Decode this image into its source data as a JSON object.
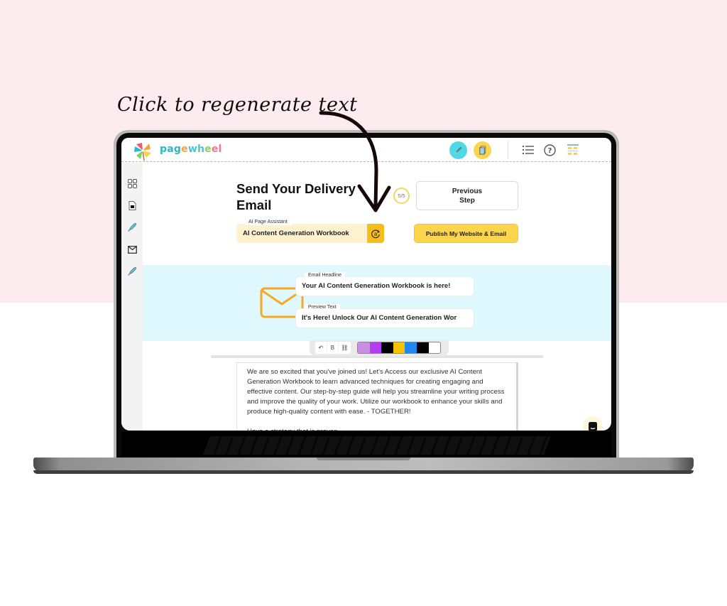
{
  "annotation": {
    "callout_text": "Click to regenerate text",
    "arrow_icon": "curved-arrow-down"
  },
  "colors": {
    "background_top": "#fdecef",
    "background_bottom": "#ffffff",
    "accent_yellow": "#fbd54c",
    "regen_yellow": "#f7be1a",
    "email_band": "#dff8fd",
    "envelope_orange": "#f9a826"
  },
  "app": {
    "brand": {
      "name_letters": [
        {
          "ch": "p",
          "color": "#2bb8c7"
        },
        {
          "ch": "a",
          "color": "#2bb8c7"
        },
        {
          "ch": "g",
          "color": "#2bb8c7"
        },
        {
          "ch": "e",
          "color": "#f6a23a"
        },
        {
          "ch": "w",
          "color": "#4fc4cf"
        },
        {
          "ch": "h",
          "color": "#4fc4cf"
        },
        {
          "ch": "e",
          "color": "#8fcf5a"
        },
        {
          "ch": "e",
          "color": "#f2788c"
        },
        {
          "ch": "l",
          "color": "#f2788c"
        }
      ],
      "logo_icon": "pinwheel-logo"
    },
    "topbar": {
      "buttons": [
        {
          "name": "rocket-button",
          "icon": "rocket-icon",
          "bg": "#4fd8e6"
        },
        {
          "name": "pages-button",
          "icon": "document-icon",
          "bg": "#fbd54c"
        }
      ],
      "icons": [
        {
          "name": "list-icon"
        },
        {
          "name": "help-icon",
          "glyph": "?"
        },
        {
          "name": "preview-thumbnail-icon"
        }
      ]
    },
    "sidebar": {
      "items": [
        {
          "name": "sidebar-item-dashboard",
          "icon": "grid-icon"
        },
        {
          "name": "sidebar-item-page",
          "icon": "document-icon"
        },
        {
          "name": "sidebar-item-launch",
          "icon": "rocket-icon"
        },
        {
          "name": "sidebar-item-email",
          "icon": "mail-icon"
        },
        {
          "name": "sidebar-item-publish",
          "icon": "rocket-icon"
        }
      ]
    },
    "step": {
      "title": "Send Your Delivery Email",
      "progress": "5/5",
      "previous_label": "Previous\nStep"
    },
    "ai_assistant": {
      "label": "AI Page Assistant",
      "value": "AI Content Generation Workbook",
      "regen_icon": "regenerate-ai-icon"
    },
    "publish_label": "Publish My Website & Email",
    "email": {
      "headline_label": "Email Headline",
      "headline_value": "Your AI Content Generation Workbook is here!",
      "preview_label": "Preview Text",
      "preview_value": "It's Here! Unlock Our AI Content Generation Wor"
    },
    "editor": {
      "format_buttons": [
        {
          "name": "undo-button",
          "icon": "undo-icon",
          "glyph": "↶"
        },
        {
          "name": "bold-button",
          "icon": "bold-icon",
          "glyph": "B"
        },
        {
          "name": "link-button",
          "icon": "link-icon",
          "glyph": "⛓"
        }
      ],
      "swatches": [
        "#c98fe0",
        "#b13ff0",
        "#000000",
        "#f7c300",
        "#1e88f0",
        "#000000",
        "#ffffff"
      ],
      "paragraphs": [
        "We are so excited that you've joined us! Let's Access our exclusive AI Content Generation Workbook to learn advanced techniques for creating engaging and effective content. Our step-by-step guide will help you streamline your writing process and improve the quality of your work. Utilize our workbook to enhance your skills and produce high-quality content with ease. - TOGETHER!",
        "Have a strategy that is proven..."
      ]
    },
    "chat_icon": "chat-support-icon"
  }
}
